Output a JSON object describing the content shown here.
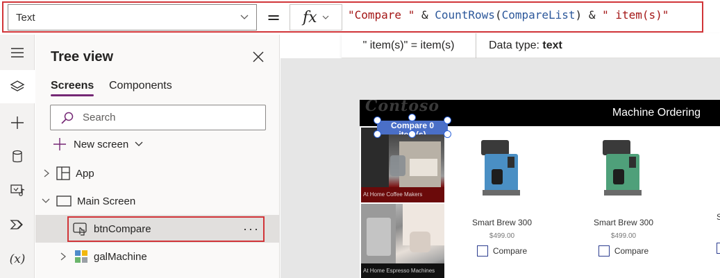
{
  "formula_bar": {
    "property": "Text",
    "equals": "=",
    "fx_label": "fx",
    "formula_parts": [
      {
        "text": "\"Compare \"",
        "kind": "str"
      },
      {
        "text": " & ",
        "kind": "op"
      },
      {
        "text": "CountRows",
        "kind": "fn"
      },
      {
        "text": "(",
        "kind": "op"
      },
      {
        "text": "CompareList",
        "kind": "fn"
      },
      {
        "text": ")",
        "kind": "op"
      },
      {
        "text": " & ",
        "kind": "op"
      },
      {
        "text": "\" item(s)\"",
        "kind": "str"
      }
    ],
    "hint_left": "\" item(s)\"  =  item(s)",
    "hint_type_label": "Data type:",
    "hint_type_value": "text",
    "colors": {
      "string": "#a31515",
      "function": "#2b579a",
      "highlight": "#d13438"
    }
  },
  "rail": {
    "items": [
      "hamburger-icon",
      "layers-icon",
      "plus-icon",
      "database-icon",
      "media-icon",
      "power-automate-icon",
      "variables-icon"
    ],
    "variables_label": "(x)"
  },
  "tree": {
    "title": "Tree view",
    "tabs": [
      "Screens",
      "Components"
    ],
    "search_placeholder": "Search",
    "new_screen_label": "New screen",
    "nodes": {
      "app": "App",
      "main_screen": "Main Screen",
      "btn_compare": "btnCompare",
      "gal_machine": "galMachine"
    },
    "more_label": "···",
    "accent": "#742774"
  },
  "canvas": {
    "logo": "Contoso",
    "header_title": "Machine Ordering",
    "compare_button": "Compare 0 item(s)",
    "categories": [
      "At Home Coffee Makers",
      "At Home Espresso Machines"
    ],
    "products": [
      {
        "name": "Smart Brew 300",
        "price": "$499.00",
        "compare_label": "Compare",
        "accent": "#4a8fc4"
      },
      {
        "name": "Smart Brew 300",
        "price": "$499.00",
        "compare_label": "Compare",
        "accent": "#4fa07a"
      }
    ],
    "partial_product_letter": "S"
  }
}
